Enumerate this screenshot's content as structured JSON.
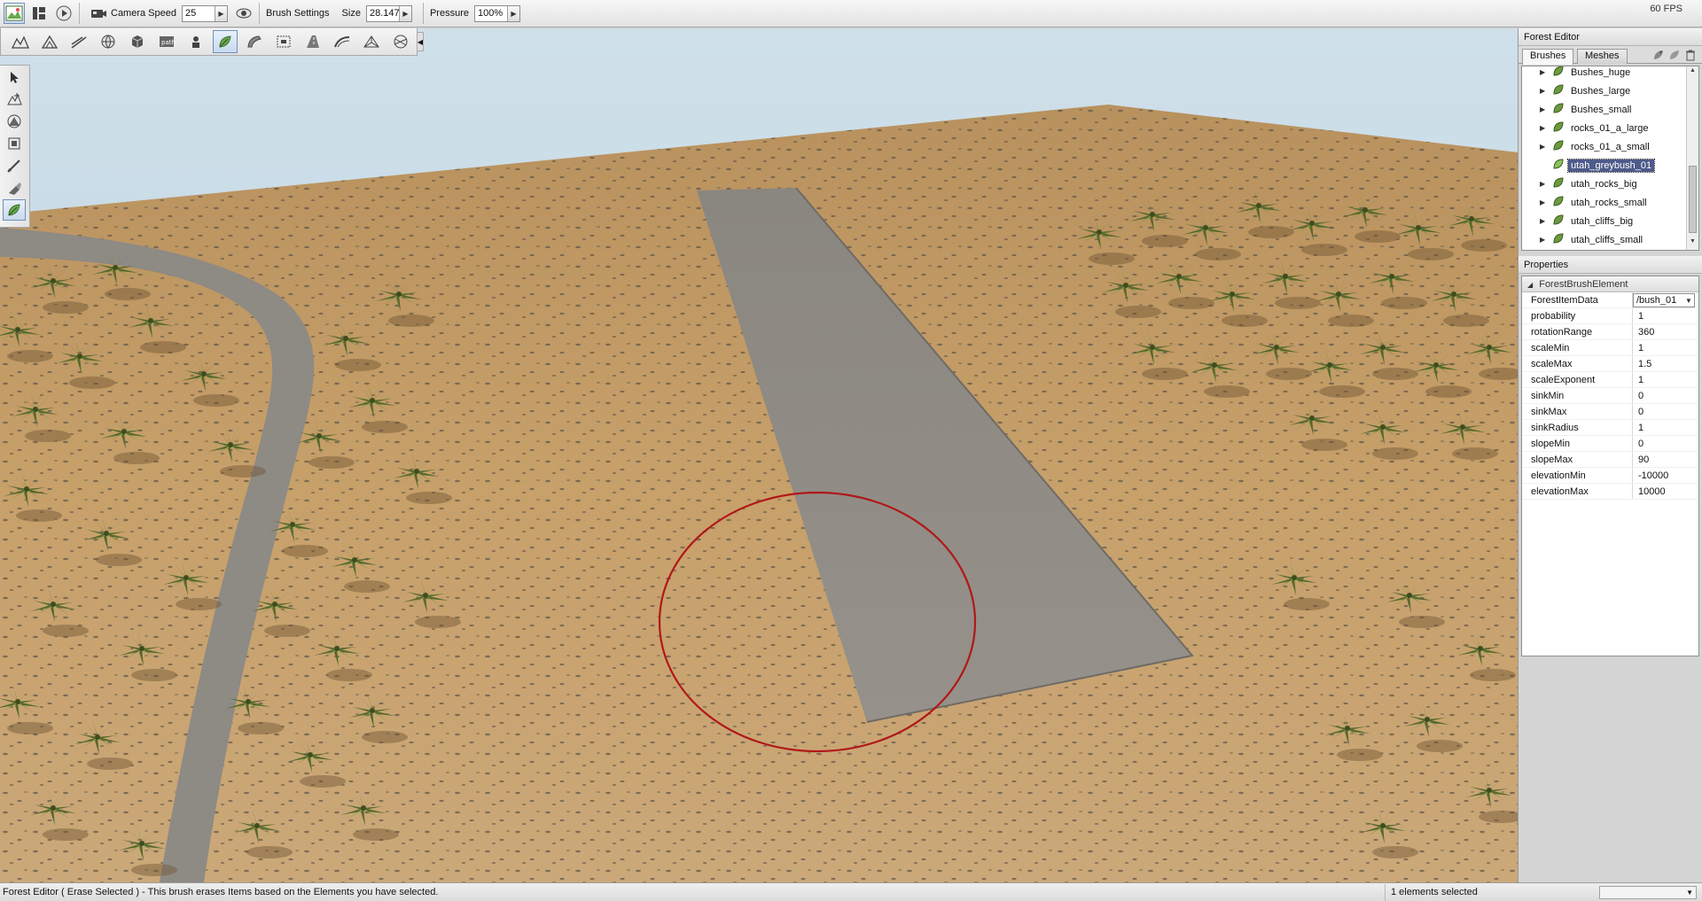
{
  "topbar": {
    "camera_speed_label": "Camera Speed",
    "camera_speed_value": "25",
    "brush_settings_label": "Brush Settings",
    "size_label": "Size",
    "size_value": "28.147",
    "pressure_label": "Pressure",
    "pressure_value": "100%",
    "fps": "60 FPS"
  },
  "forest_editor": {
    "title": "Forest Editor",
    "tabs": [
      "Brushes",
      "Meshes"
    ],
    "active_tab": "Brushes",
    "brushes": [
      {
        "label": "Bushes_huge"
      },
      {
        "label": "Bushes_large"
      },
      {
        "label": "Bushes_small"
      },
      {
        "label": "rocks_01_a_large"
      },
      {
        "label": "rocks_01_a_small"
      },
      {
        "label": "utah_greybush_01",
        "selected": true
      },
      {
        "label": "utah_rocks_big"
      },
      {
        "label": "utah_rocks_small"
      },
      {
        "label": "utah_cliffs_big"
      },
      {
        "label": "utah_cliffs_small"
      }
    ]
  },
  "properties": {
    "title": "Properties",
    "group": "ForestBrushElement",
    "forest_item_data_label": "ForestItemData",
    "forest_item_data_value": "/bush_01",
    "rows": [
      {
        "key": "probability",
        "value": "1"
      },
      {
        "key": "rotationRange",
        "value": "360"
      },
      {
        "key": "scaleMin",
        "value": "1"
      },
      {
        "key": "scaleMax",
        "value": "1.5"
      },
      {
        "key": "scaleExponent",
        "value": "1"
      },
      {
        "key": "sinkMin",
        "value": "0"
      },
      {
        "key": "sinkMax",
        "value": "0"
      },
      {
        "key": "sinkRadius",
        "value": "1"
      },
      {
        "key": "slopeMin",
        "value": "0"
      },
      {
        "key": "slopeMax",
        "value": "90"
      },
      {
        "key": "elevationMin",
        "value": "-10000"
      },
      {
        "key": "elevationMax",
        "value": "10000"
      }
    ]
  },
  "status": {
    "message": "Forest Editor ( Erase Selected ) - This brush erases Items based on the Elements you have selected.",
    "selection": "1 elements selected"
  },
  "colors": {
    "sky": "#c7dbe6",
    "terrain": "#c49a62",
    "road": "#8f8a82",
    "brush_circle": "#b01818",
    "selection": "#4e5a8a"
  },
  "icons": {
    "toolbar": [
      "terrain-editor-icon",
      "layout-icon",
      "play-icon",
      "camera-icon",
      "visibility-icon"
    ],
    "tools": [
      "terrain-icon",
      "mesh-road-icon",
      "river-icon",
      "sphere-icon",
      "object-icon",
      "path-icon",
      "spawn-icon",
      "forest-icon",
      "decal-icon",
      "node-icon",
      "road-icon",
      "mesh-icon",
      "navmesh-icon"
    ],
    "palette": [
      "select-arrow-icon",
      "move-icon",
      "rotate-icon",
      "scale-icon",
      "paint-icon",
      "erase-icon",
      "leaf-icon"
    ]
  }
}
